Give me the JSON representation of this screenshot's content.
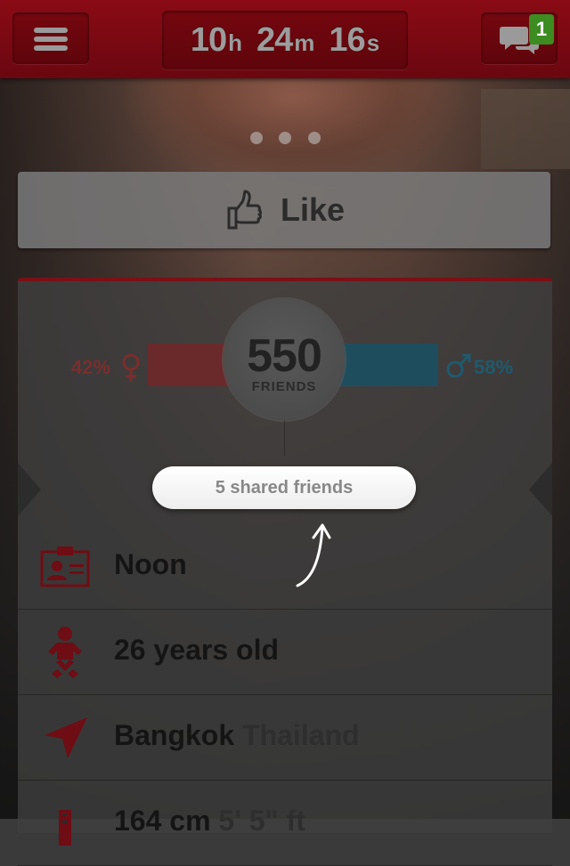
{
  "header": {
    "timer": {
      "hours": "10",
      "hours_unit": "h",
      "minutes": "24",
      "minutes_unit": "m",
      "seconds": "16",
      "seconds_unit": "s"
    },
    "messages_badge": "1",
    "icons": {
      "menu": "hamburger-menu-icon",
      "messages": "chat-bubbles-icon"
    }
  },
  "photo_carousel": {
    "pages": 3
  },
  "like_button": {
    "label": "Like",
    "icon": "thumbs-up-icon"
  },
  "friends_stats": {
    "count": "550",
    "count_label": "FRIENDS",
    "female_percent": "42%",
    "male_percent": "58%",
    "female_share": 0.42,
    "male_share": 0.58,
    "female_color": "#6a2a2b",
    "male_color": "#1e4e5e"
  },
  "shared_friends": {
    "label": "5 shared friends"
  },
  "profile": {
    "name": "Noon",
    "age": "26 years old",
    "city": "Bangkok",
    "country": "Thailand",
    "height": "164 cm",
    "height_imperial": "5' 5\" ft",
    "icon_color": "#6e0d14"
  },
  "colors": {
    "brand_red": "#7a0a12",
    "badge_green": "#3c8c22"
  }
}
